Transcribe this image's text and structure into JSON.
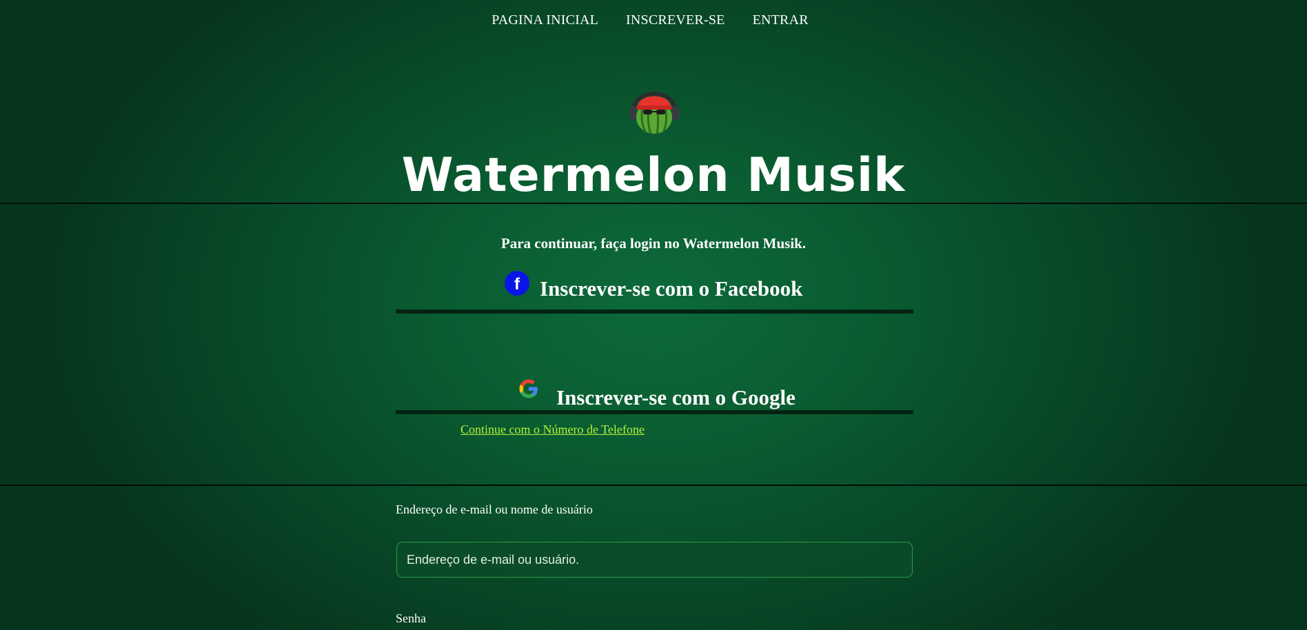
{
  "nav": {
    "items": [
      {
        "label": "PAGINA INICIAL"
      },
      {
        "label": "INSCREVER-SE"
      },
      {
        "label": "ENTRAR"
      }
    ]
  },
  "brand": {
    "title": "Watermelon Musik",
    "logo_icon": "watermelon-with-headphones-logo"
  },
  "login": {
    "prompt": "Para continuar, faça login no Watermelon Musik.",
    "facebook_label": "Inscrever-se com o Facebook",
    "facebook_icon": "facebook-icon",
    "google_label": "Inscrever-se com o Google",
    "google_icon": "google-icon",
    "phone_link": "Continue com o Número de Telefone"
  },
  "form": {
    "email_label": "Endereço de e-mail ou nome de usuário",
    "email_placeholder": "Endereço de e-mail ou usuário.",
    "password_label": "Senha"
  },
  "colors": {
    "background": "#0a5c31",
    "link": "#b6f23a",
    "facebook": "#0a16e6",
    "divider": "#020c06"
  }
}
